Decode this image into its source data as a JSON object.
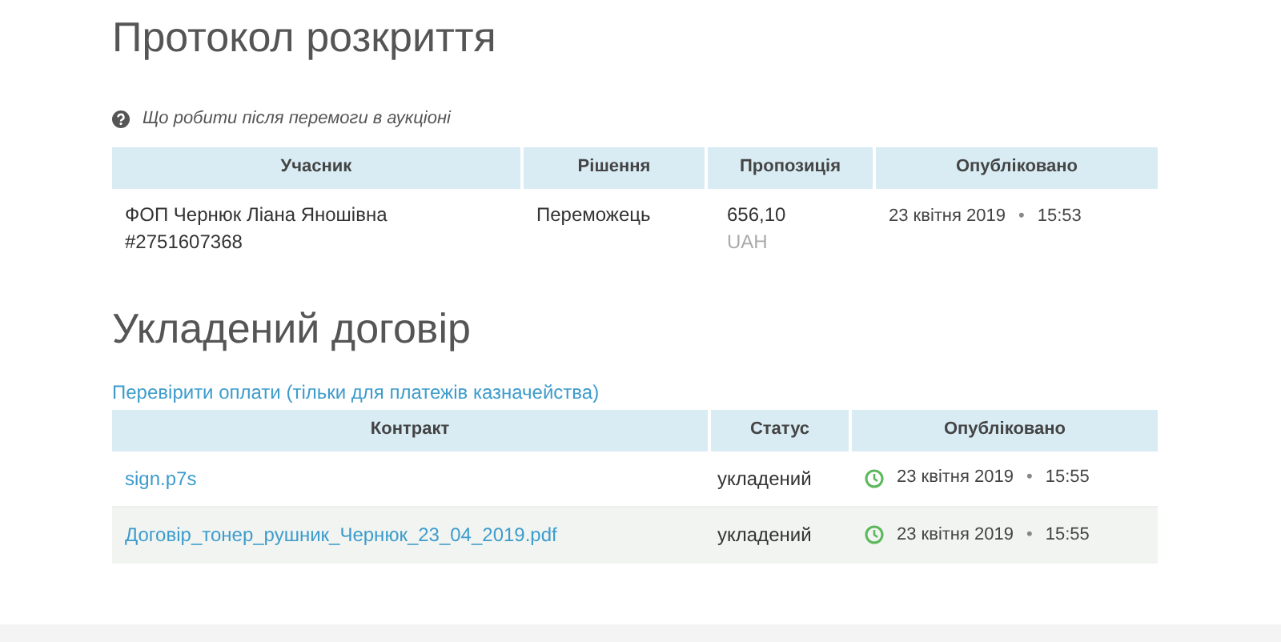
{
  "protocol": {
    "title": "Протокол розкриття",
    "help_link": "Що робити після перемоги в аукціоні",
    "columns": [
      "Учасник",
      "Рішення",
      "Пропозиція",
      "Опубліковано"
    ],
    "rows": [
      {
        "participant": [
          "ФОП Чернюк Ліана Яношівна",
          "#2751607368"
        ],
        "decision": "Переможець",
        "amount": "656,10",
        "currency": "UAH",
        "date": "23 квітня 2019",
        "bullet": "•",
        "time": "15:53"
      }
    ]
  },
  "contract": {
    "title": "Укладений договір",
    "check_link": "Перевірити оплати (тільки для платежів казначейства)",
    "columns": [
      "Контракт",
      "Статус",
      "Опубліковано"
    ],
    "rows": [
      {
        "file": "sign.p7s",
        "status": "укладений",
        "date": "23 квітня 2019",
        "bullet": "•",
        "time": "15:55"
      },
      {
        "file": "Договір_тонер_рушник_Чернюк_23_04_2019.pdf",
        "status": "укладений",
        "date": "23 квітня 2019",
        "bullet": "•",
        "time": "15:55"
      }
    ]
  }
}
